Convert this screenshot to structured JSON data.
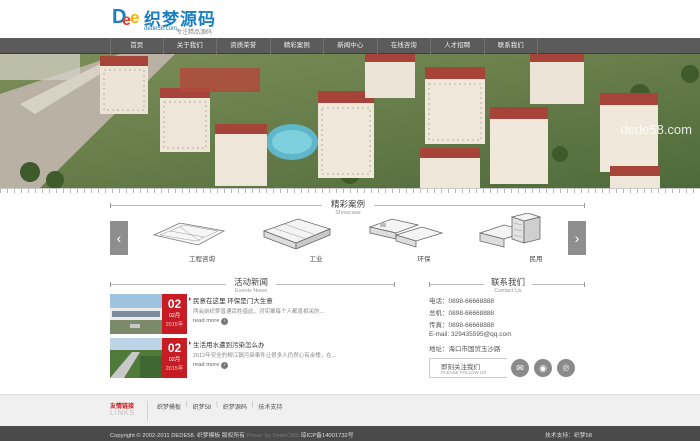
{
  "logo": {
    "name": "织梦源码",
    "domain": "dede58.com",
    "slogan": "专注精品源码"
  },
  "nav": [
    "首页",
    "关于我们",
    "资质荣誉",
    "精彩案例",
    "新闻中心",
    "在线咨询",
    "人才招聘",
    "联系我们"
  ],
  "banner": {
    "watermark": "dede58.com"
  },
  "showcase": {
    "title": "精彩案例",
    "subtitle": "Showcase",
    "prev_icon": "‹",
    "next_icon": "›",
    "items": [
      {
        "label": "工程咨询",
        "icon": "blueprint-icon"
      },
      {
        "label": "工业",
        "icon": "factory-icon"
      },
      {
        "label": "环保",
        "icon": "eco-plant-icon"
      },
      {
        "label": "民用",
        "icon": "residential-icon"
      }
    ]
  },
  "news": {
    "title": "活动新闻",
    "subtitle": "Events News",
    "more_label": "read more",
    "items": [
      {
        "day": "02",
        "month": "02月",
        "year": "2015年",
        "title": "民意在这里 环保是门大生意",
        "summary": "两会前织梦普通百姓借此，对实聚每个人都息相关的..."
      },
      {
        "day": "02",
        "month": "02月",
        "year": "2015年",
        "title": "生活用水遭到污染怎么办",
        "summary": "2012年安全的柳江镉污染事件让很多人仍然心有余悸，在..."
      }
    ]
  },
  "contact": {
    "title": "联系我们",
    "subtitle": "Contact Us",
    "phone": "电话：0898-66668888",
    "mobile": "总机：0898-66668888",
    "fax": "传真：0898-66668888",
    "email": "E-mail: 329435595@qq.com",
    "address": "地址：海口市国贸玉沙路",
    "follow_cn": "即刻关注我们",
    "follow_en": "PLEASE FOLLOW US",
    "social": [
      {
        "name": "email-icon",
        "glyph": "✉"
      },
      {
        "name": "weibo-icon",
        "glyph": "◉"
      },
      {
        "name": "pinterest-icon",
        "glyph": "℗"
      }
    ]
  },
  "links": {
    "title_cn": "友情链接",
    "title_en": "LINKS",
    "items": [
      "织梦模板",
      "织梦58",
      "织梦源码",
      "技术支持"
    ]
  },
  "footer": {
    "copyright": "Copyright © 2002-2011 DEDE58. 织梦模板 版权所有",
    "powered": " Power by DedeCMS ",
    "icp": "琼ICP备14001732号",
    "support": "技术支持：织梦58"
  },
  "colors": {
    "accent": "#c81c24",
    "nav_bg": "#5b5b5b",
    "footer_bg": "#4a4a4a",
    "logo_blue": "#1b7fc4"
  }
}
